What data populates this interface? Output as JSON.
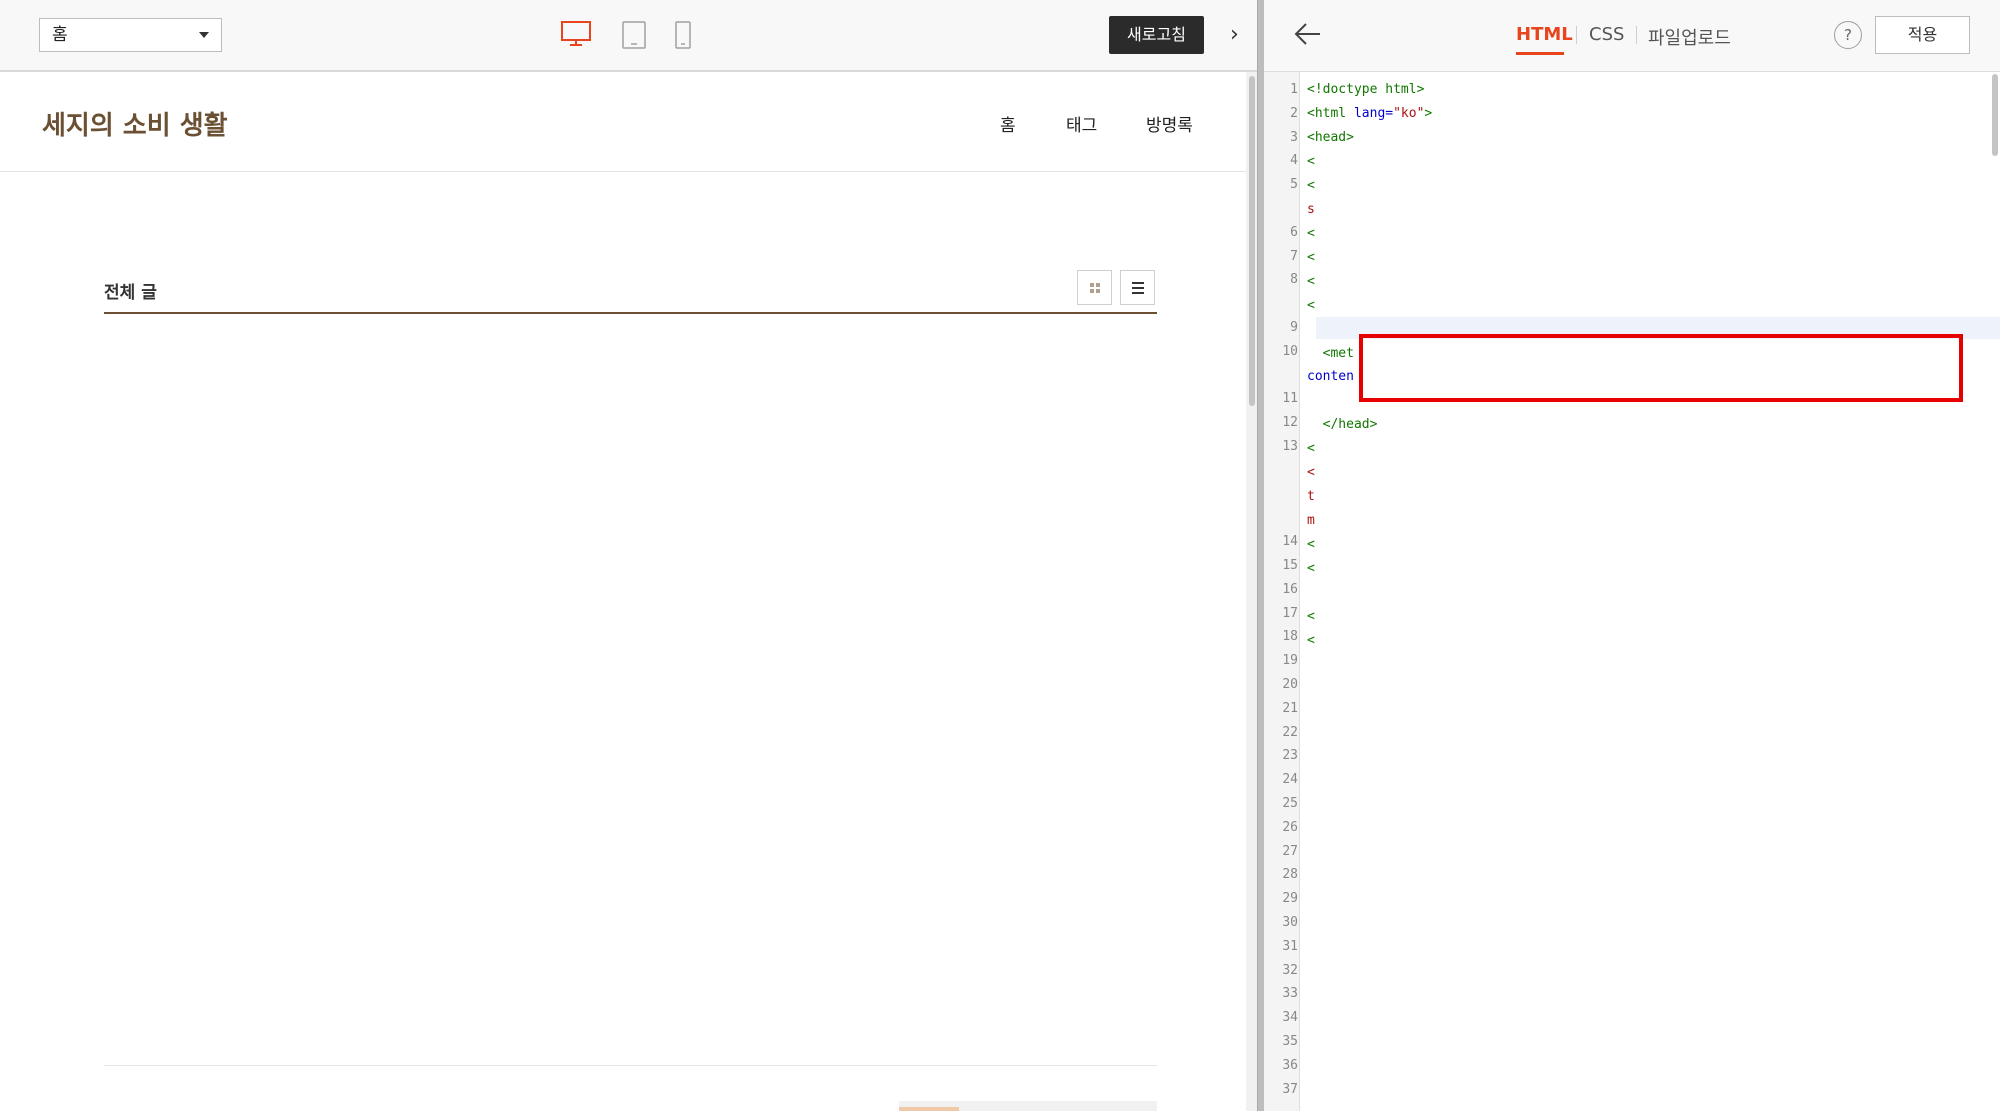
{
  "toolbar": {
    "page_select": "홈",
    "devices": [
      "desktop-icon",
      "tablet-icon",
      "mobile-icon"
    ],
    "refresh_label": "새로고침",
    "toggle_arrow": "›"
  },
  "blog": {
    "title": "세지의 소비 생활",
    "nav": [
      "홈",
      "태그",
      "방명록"
    ],
    "section_title": "전체 글"
  },
  "editor": {
    "tabs": [
      "HTML",
      "CSS",
      "파일업로드"
    ],
    "active_tab": "HTML",
    "help": "?",
    "apply_label": "적용",
    "line_numbers": [
      "1",
      "2",
      "3",
      "4",
      "5",
      "",
      "6",
      "7",
      "8",
      "",
      "9",
      "10",
      "",
      "11",
      "12",
      "13",
      "",
      "",
      "",
      "14",
      "15",
      "16",
      "17",
      "18",
      "19",
      "20",
      "21",
      "22",
      "23",
      "24",
      "25",
      "26",
      "27",
      "28",
      "29",
      "30",
      "31",
      "32",
      "33",
      "34",
      "35",
      "36",
      "37"
    ],
    "code_lines": {
      "l1": "<!doctype html>",
      "l2_tag": "<html ",
      "l2_attr": "lang=",
      "l2_str": "\"ko\"",
      "l2_end": ">",
      "l3": "<head>",
      "lt": "<",
      "s": "s",
      "t": "t",
      "m": "m",
      "l10": "  <met",
      "l10b": "conten",
      "l12": "  </head>"
    }
  },
  "colors": {
    "accent": "#e8441d",
    "blog_brown": "#6b5033",
    "highlight": "#e60000"
  }
}
